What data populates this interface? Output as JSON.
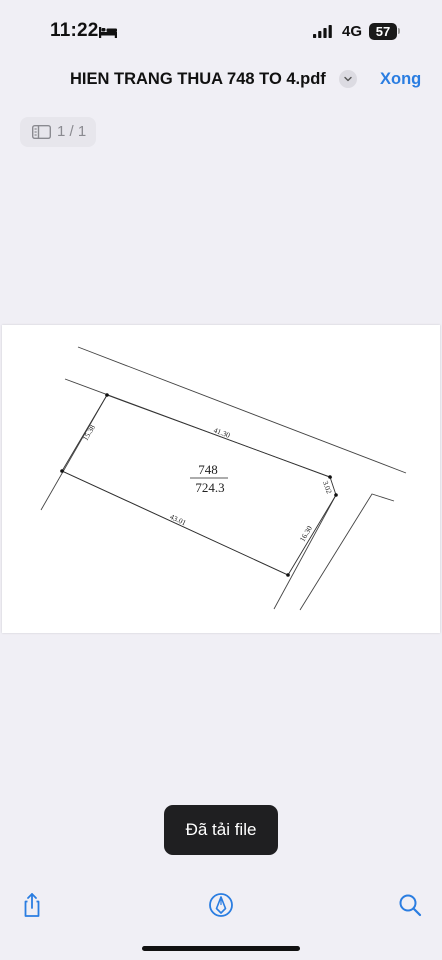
{
  "status_bar": {
    "time": "11:22",
    "network": "4G",
    "battery_level": "57",
    "icons": [
      "bed-icon",
      "cellular-signal-icon",
      "battery-icon"
    ]
  },
  "nav": {
    "document_title": "HIEN TRANG THUA 748 TO 4.pdf",
    "done_label": "Xong",
    "accent_color": "#2a7de1",
    "icons": [
      "chevron-down-icon"
    ]
  },
  "page_indicator": {
    "text": "1 / 1",
    "icon": "page-thumbnails-icon"
  },
  "document": {
    "parcel_number": "748",
    "parcel_area": "724.3",
    "edge_lengths": {
      "top": "41.30",
      "left": "15.38",
      "bottom": "43.01",
      "right": "16.30",
      "corner": "3.02"
    }
  },
  "toast": {
    "message": "Đã tải file"
  },
  "toolbar": {
    "icons": [
      "share-icon",
      "markup-icon",
      "search-icon"
    ]
  }
}
